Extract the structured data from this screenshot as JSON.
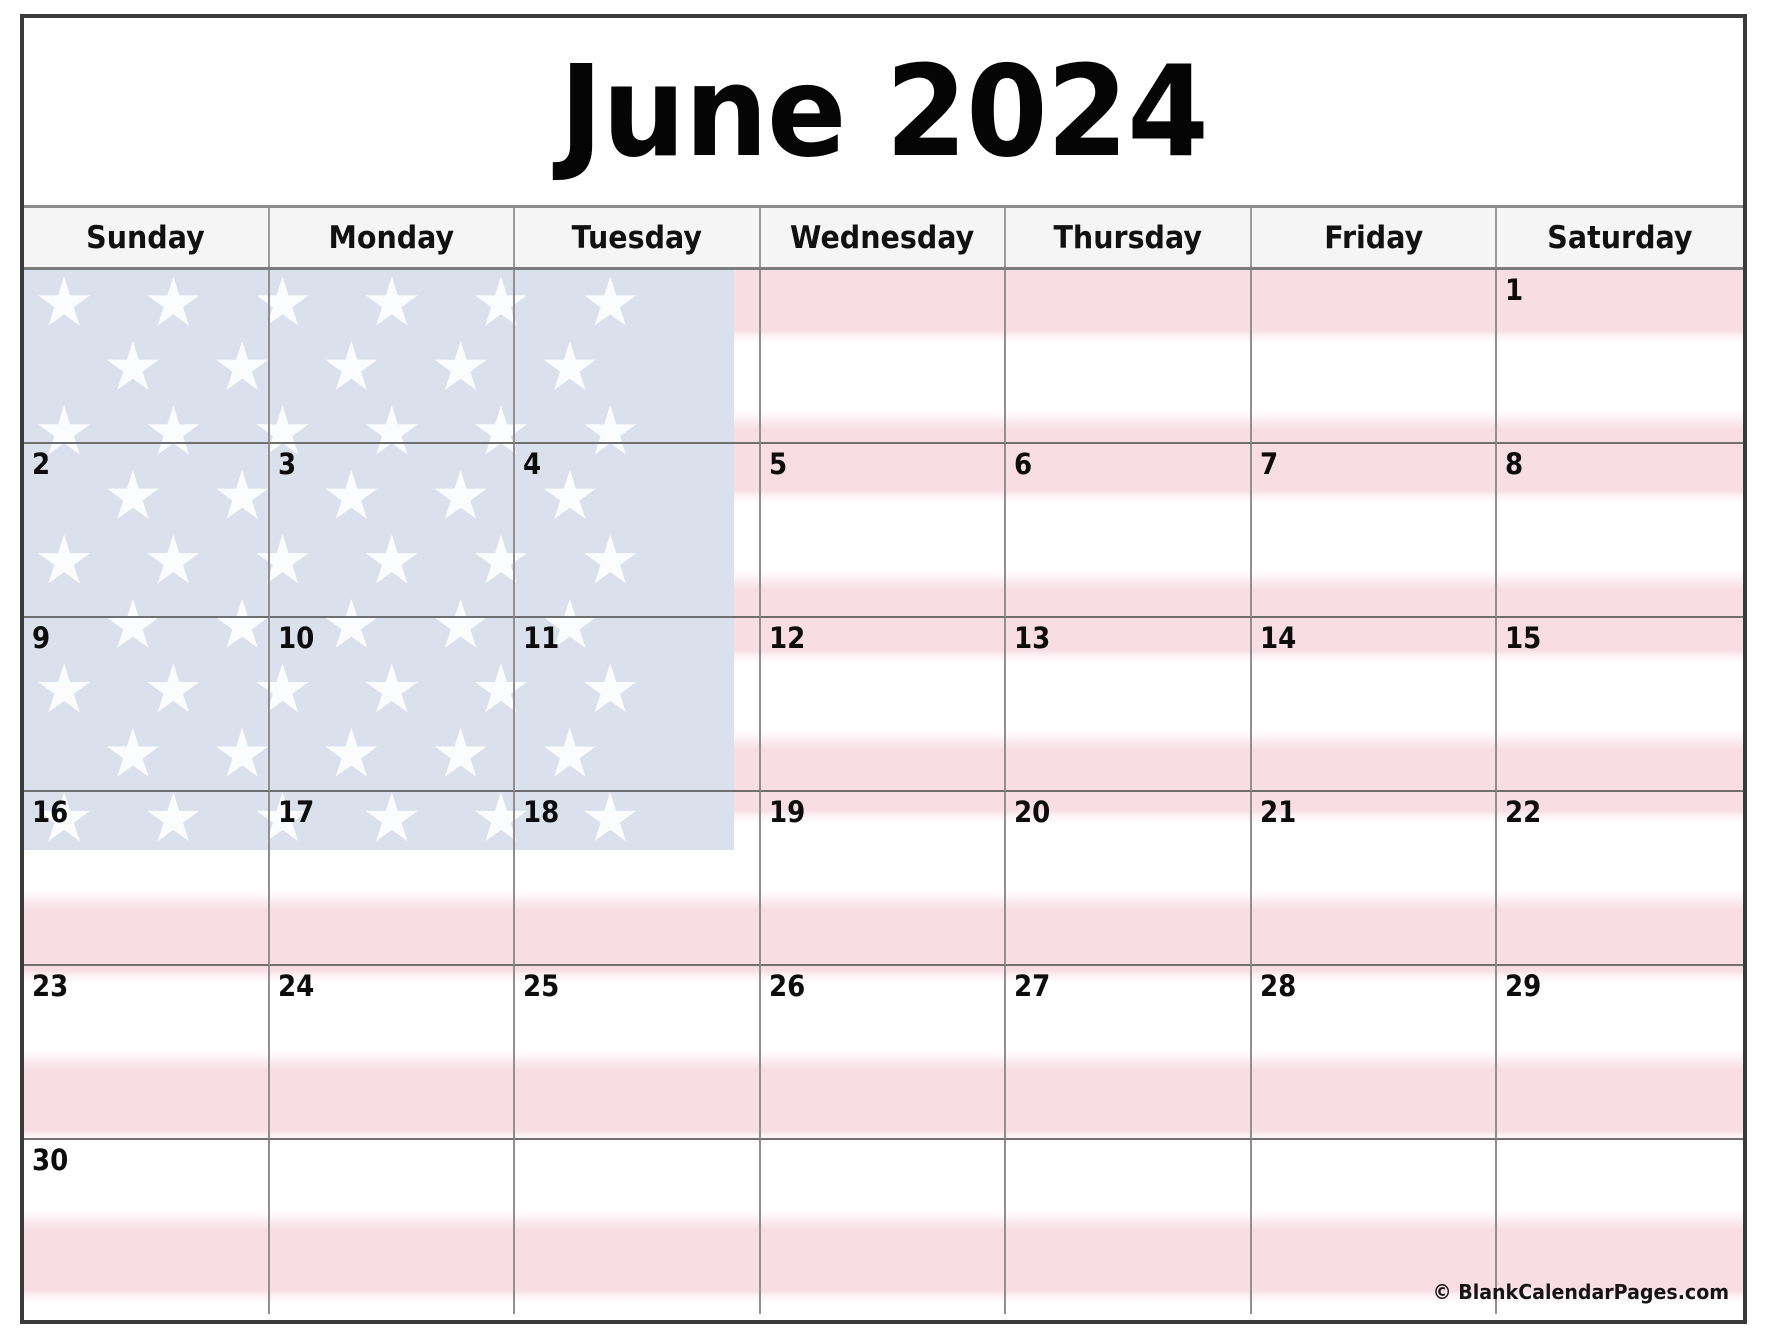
{
  "calendar": {
    "title": "June 2024",
    "month": "June",
    "year": "2024",
    "weekdays": [
      "Sunday",
      "Monday",
      "Tuesday",
      "Wednesday",
      "Thursday",
      "Friday",
      "Saturday"
    ],
    "weeks": [
      [
        "",
        "",
        "",
        "",
        "",
        "",
        "1"
      ],
      [
        "2",
        "3",
        "4",
        "5",
        "6",
        "7",
        "8"
      ],
      [
        "9",
        "10",
        "11",
        "12",
        "13",
        "14",
        "15"
      ],
      [
        "16",
        "17",
        "18",
        "19",
        "20",
        "21",
        "22"
      ],
      [
        "23",
        "24",
        "25",
        "26",
        "27",
        "28",
        "29"
      ],
      [
        "30",
        "",
        "",
        "",
        "",
        "",
        ""
      ]
    ],
    "background_theme": "usa-flag-faded",
    "credit": "© BlankCalendarPages.com",
    "colors": {
      "frame_border": "#3a3a3a",
      "grid_line": "#8f8f8f",
      "header_background": "#f5f5f5",
      "stripe_pink": "#f8dde5",
      "stripe_white": "#ffffff",
      "canton_blue": "#dbe1ec",
      "star_white": "#fdfdfe",
      "text": "#0d0d0d"
    }
  }
}
